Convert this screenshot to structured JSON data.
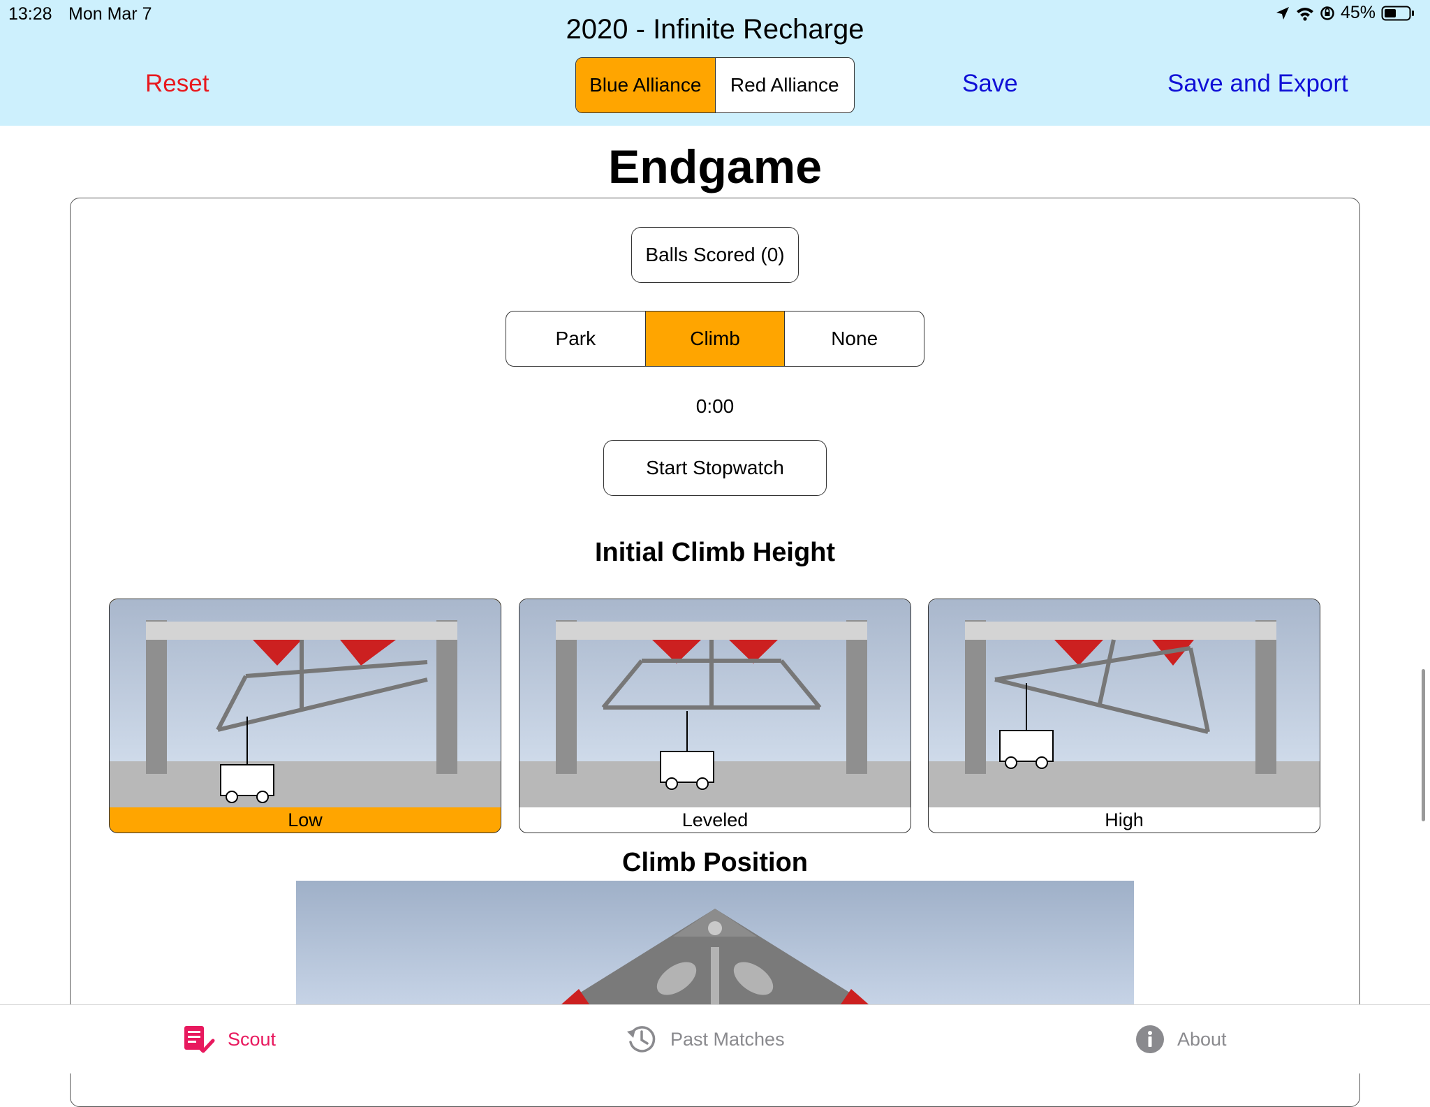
{
  "status_bar": {
    "time": "13:28",
    "date": "Mon Mar 7",
    "battery": "45%"
  },
  "header": {
    "title": "2020 - Infinite Recharge",
    "reset_label": "Reset",
    "save_label": "Save",
    "save_export_label": "Save and Export",
    "alliances": [
      "Blue Alliance",
      "Red Alliance"
    ],
    "selected_alliance": "Blue Alliance"
  },
  "main": {
    "title": "Endgame",
    "balls_scored_label": "Balls Scored (0)",
    "endgame_options": [
      "Park",
      "Climb",
      "None"
    ],
    "selected_endgame": "Climb",
    "timer": "0:00",
    "stopwatch_label": "Start Stopwatch",
    "climb_height_title": "Initial Climb Height",
    "climb_heights": [
      "Low",
      "Leveled",
      "High"
    ],
    "selected_height": "Low",
    "climb_position_title": "Climb Position"
  },
  "tabbar": {
    "scout": "Scout",
    "past_matches": "Past Matches",
    "about": "About"
  },
  "colors": {
    "accent": "#ffa500",
    "header_bg": "#cdf0fd",
    "destructive": "#e8191e",
    "link": "#1010d6",
    "tab_active": "#e8195e"
  },
  "icons": {
    "scout": "checklist-icon",
    "past_matches": "history-clock-icon",
    "about": "info-circle-icon"
  }
}
